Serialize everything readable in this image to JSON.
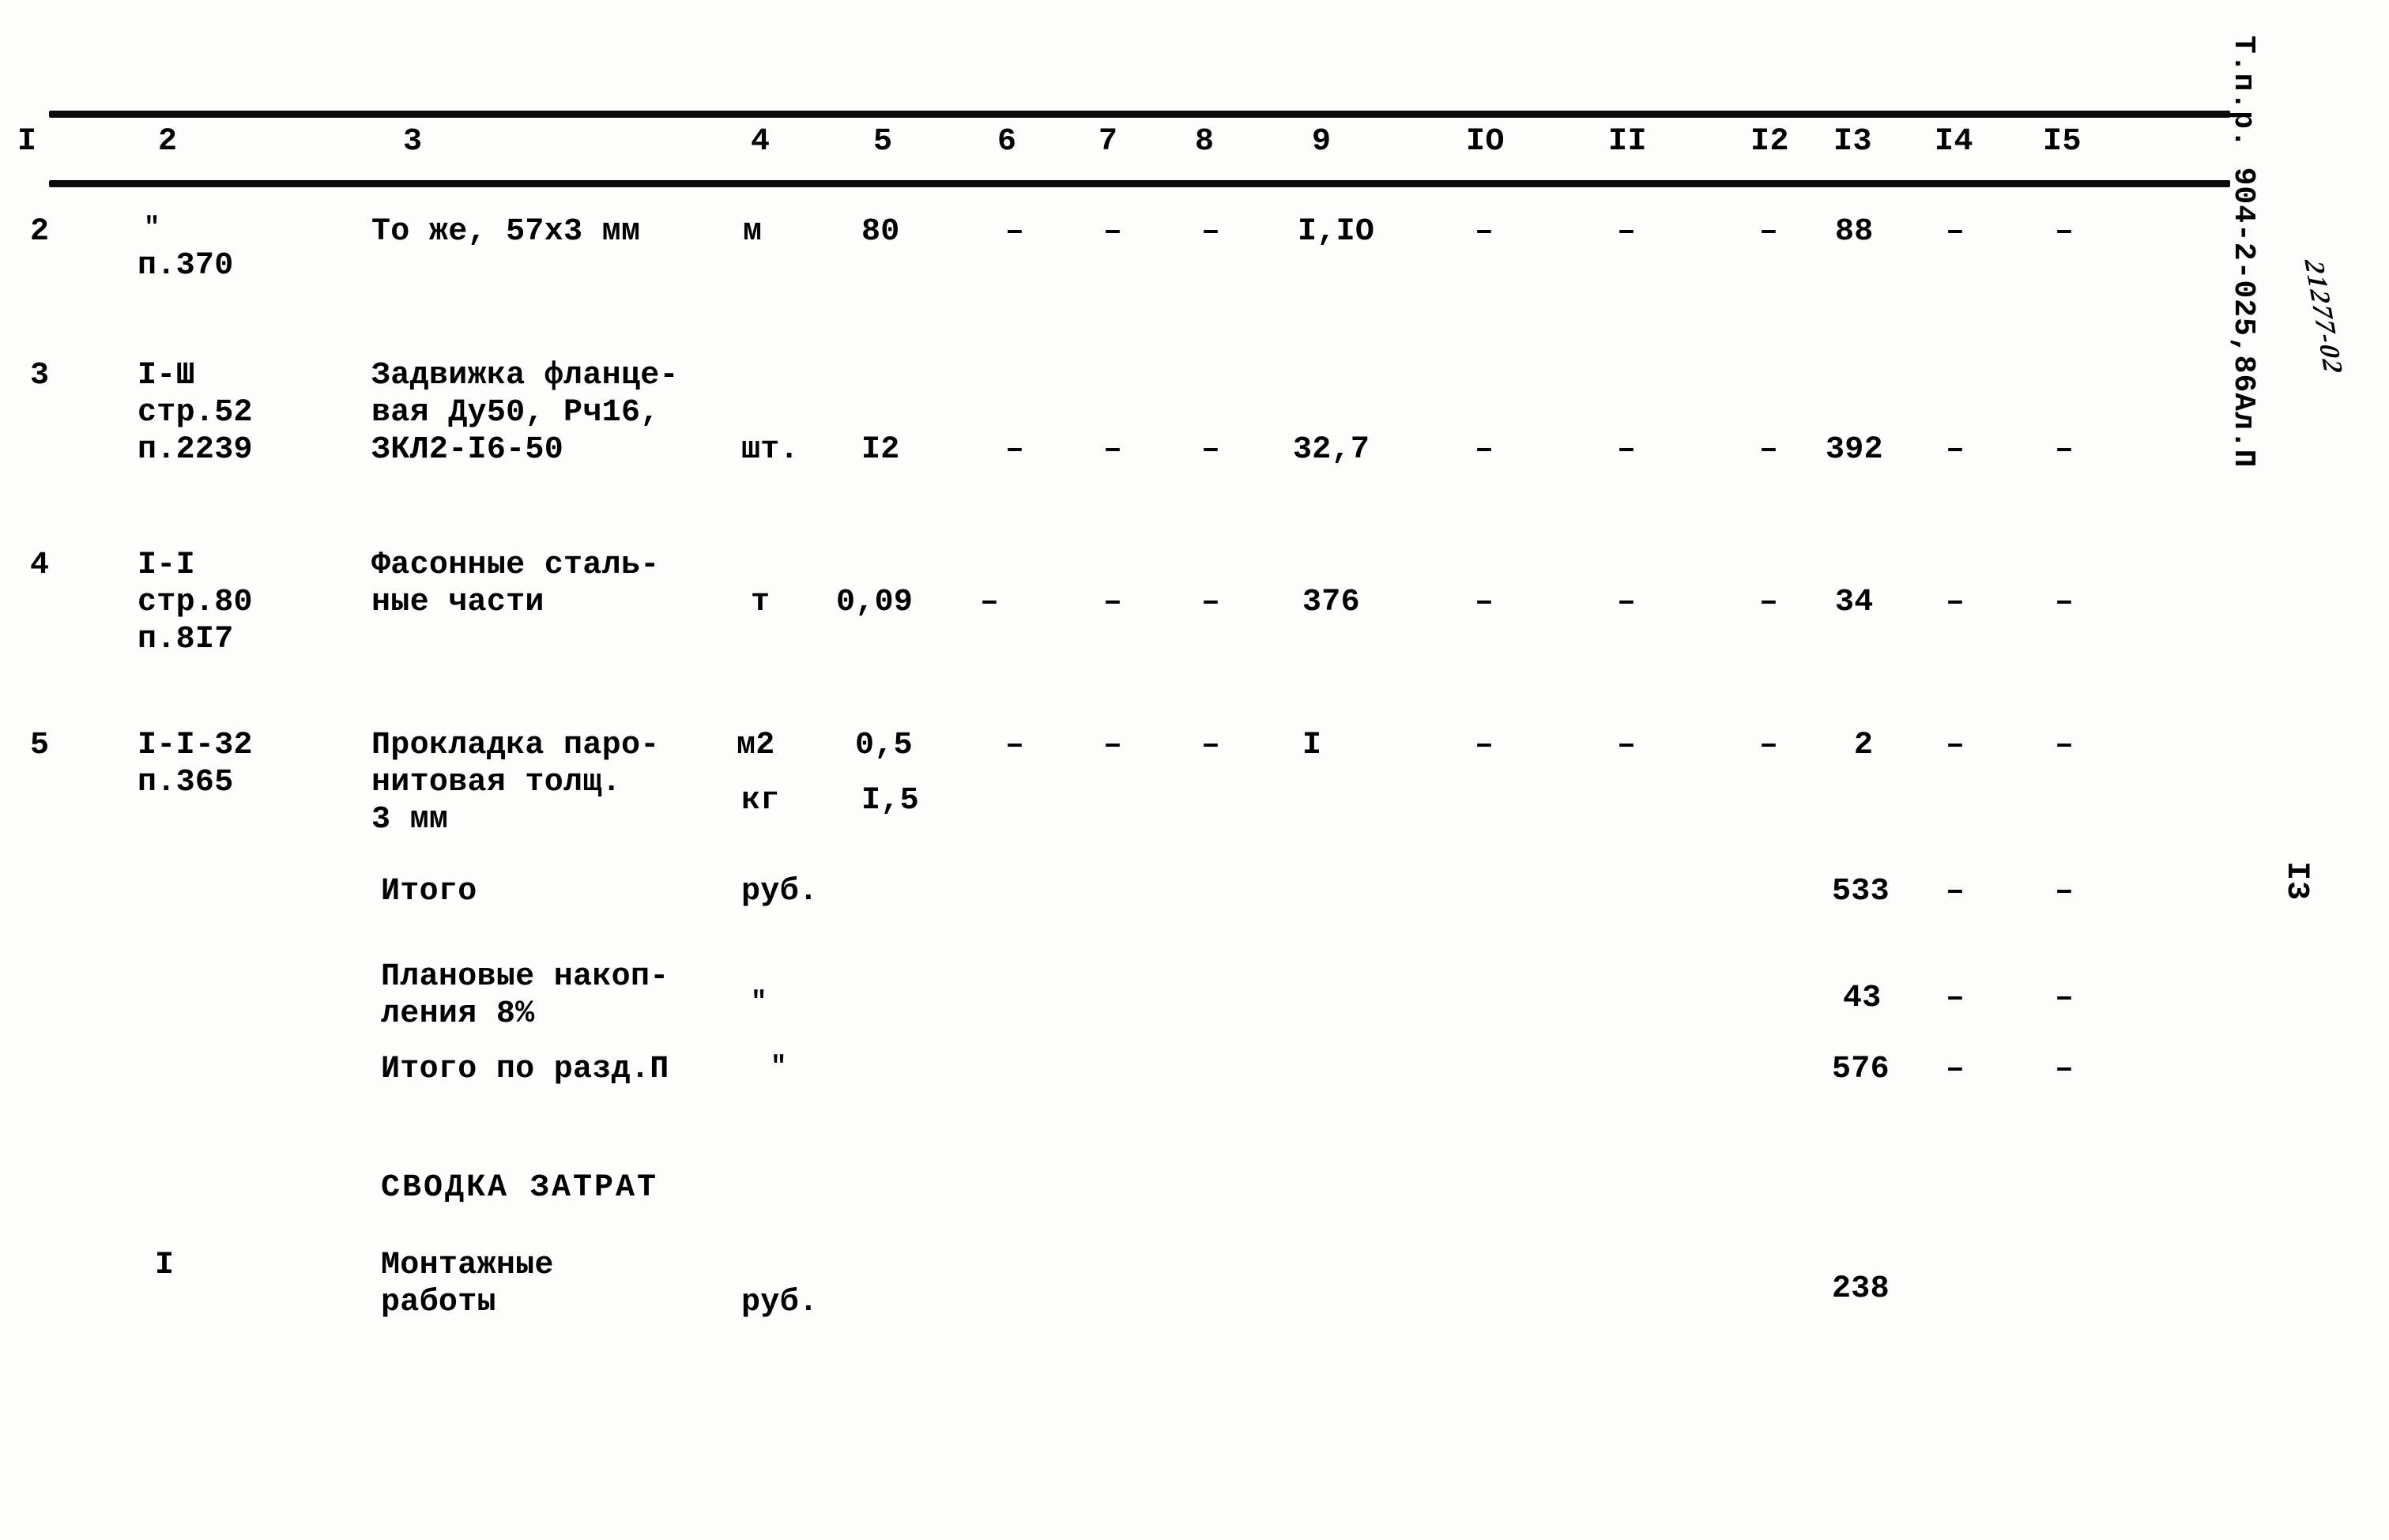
{
  "document": {
    "margin_right": {
      "tpr_code": "Т.п.р. 904-2-025,86Ал.П",
      "hand_written_code": "21277-02",
      "page_number": "I3"
    }
  },
  "table": {
    "column_numbers": [
      "I",
      "2",
      "3",
      "4",
      "5",
      "6",
      "7",
      "8",
      "9",
      "IO",
      "II",
      "I2",
      "I3",
      "I4",
      "I5"
    ],
    "rows": [
      {
        "pos": "2",
        "ref_lines": [
          "\"",
          "п.370"
        ],
        "description_lines": [
          "То же, 57х3 мм"
        ],
        "units": [
          "м"
        ],
        "qty": [
          "80"
        ],
        "c6": "–",
        "c7": "–",
        "c8": "–",
        "c9": "I,IO",
        "c10": "–",
        "c11": "–",
        "c12": "–",
        "c13": "88",
        "c14": "–",
        "c15": "–"
      },
      {
        "pos": "3",
        "ref_lines": [
          "I-Ш",
          "стр.52",
          "п.2239"
        ],
        "description_lines": [
          "Задвижка фланце-",
          "вая Ду50, Рч16,",
          "ЗКЛ2-I6-50"
        ],
        "units": [
          "шт."
        ],
        "qty": [
          "I2"
        ],
        "c6": "–",
        "c7": "–",
        "c8": "–",
        "c9": "32,7",
        "c10": "–",
        "c11": "–",
        "c12": "–",
        "c13": "392",
        "c14": "–",
        "c15": "–"
      },
      {
        "pos": "4",
        "ref_lines": [
          "I-I",
          "стр.80",
          "п.8I7"
        ],
        "description_lines": [
          "Фасонные сталь-",
          "ные части"
        ],
        "units": [
          "т"
        ],
        "qty": [
          "0,09"
        ],
        "c6": "–",
        "c7": "–",
        "c8": "–",
        "c9": "376",
        "c10": "–",
        "c11": "–",
        "c12": "–",
        "c13": "34",
        "c14": "–",
        "c15": "–"
      },
      {
        "pos": "5",
        "ref_lines": [
          "I-I-32",
          "п.365"
        ],
        "description_lines": [
          "Прокладка паро-",
          "нитовая толщ.",
          "3 мм"
        ],
        "units": [
          "м2",
          "кг"
        ],
        "qty": [
          "0,5",
          "I,5"
        ],
        "c6": "–",
        "c7": "–",
        "c8": "–",
        "c9": "I",
        "c10": "–",
        "c11": "–",
        "c12": "–",
        "c13": "2",
        "c14": "–",
        "c15": "–"
      }
    ],
    "summary_rows": [
      {
        "label_lines": [
          "Итого"
        ],
        "unit": "руб.",
        "c13": "533",
        "c14": "–",
        "c15": "–"
      },
      {
        "label_lines": [
          "Плановые накоп-",
          "ления 8%"
        ],
        "unit": "\"",
        "c13": "43",
        "c14": "–",
        "c15": "–"
      },
      {
        "label_lines": [
          "Итого по разд.П"
        ],
        "unit": "\"",
        "c13": "576",
        "c14": "–",
        "c15": "–"
      }
    ],
    "section_title": "СВОДКА ЗАТРАТ",
    "cost_summary_rows": [
      {
        "pos": "I",
        "label_lines": [
          "Монтажные",
          "работы"
        ],
        "unit": "руб.",
        "c13": "238"
      }
    ]
  }
}
